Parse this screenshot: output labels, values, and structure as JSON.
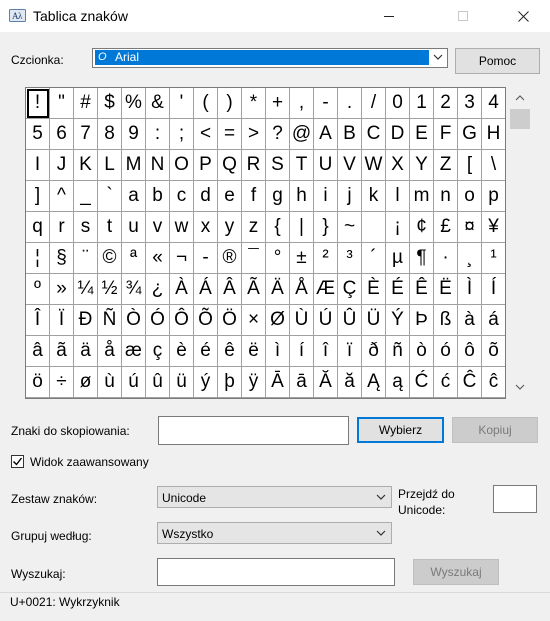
{
  "window": {
    "title": "Tablica znaków"
  },
  "font": {
    "label": "Czcionka:",
    "value": "Arial",
    "icon": "opentype-font-icon"
  },
  "help_button": "Pomoc",
  "grid": {
    "selected_index": 0,
    "rows": [
      [
        "!",
        "\"",
        "#",
        "$",
        "%",
        "&",
        "'",
        "(",
        ")",
        "*",
        "+",
        ",",
        "-",
        ".",
        "/",
        "0",
        "1",
        "2",
        "3",
        "4"
      ],
      [
        "5",
        "6",
        "7",
        "8",
        "9",
        ":",
        ";",
        "<",
        "=",
        ">",
        "?",
        "@",
        "A",
        "B",
        "C",
        "D",
        "E",
        "F",
        "G",
        "H"
      ],
      [
        "I",
        "J",
        "K",
        "L",
        "M",
        "N",
        "O",
        "P",
        "Q",
        "R",
        "S",
        "T",
        "U",
        "V",
        "W",
        "X",
        "Y",
        "Z",
        "[",
        "\\"
      ],
      [
        "]",
        "^",
        "_",
        "`",
        "a",
        "b",
        "c",
        "d",
        "e",
        "f",
        "g",
        "h",
        "i",
        "j",
        "k",
        "l",
        "m",
        "n",
        "o",
        "p"
      ],
      [
        "q",
        "r",
        "s",
        "t",
        "u",
        "v",
        "w",
        "x",
        "y",
        "z",
        "{",
        "|",
        "}",
        "~",
        " ",
        "¡",
        "¢",
        "£",
        "¤",
        "¥"
      ],
      [
        "¦",
        "§",
        "¨",
        "©",
        "ª",
        "«",
        "¬",
        "-",
        "®",
        "¯",
        "°",
        "±",
        "²",
        "³",
        "´",
        "µ",
        "¶",
        "·",
        "¸",
        "¹"
      ],
      [
        "º",
        "»",
        "¼",
        "½",
        "¾",
        "¿",
        "À",
        "Á",
        "Â",
        "Ã",
        "Ä",
        "Å",
        "Æ",
        "Ç",
        "È",
        "É",
        "Ê",
        "Ë",
        "Ì",
        "Í"
      ],
      [
        "Î",
        "Ï",
        "Ð",
        "Ñ",
        "Ò",
        "Ó",
        "Ô",
        "Õ",
        "Ö",
        "×",
        "Ø",
        "Ù",
        "Ú",
        "Û",
        "Ü",
        "Ý",
        "Þ",
        "ß",
        "à",
        "á"
      ],
      [
        "â",
        "ã",
        "ä",
        "å",
        "æ",
        "ç",
        "è",
        "é",
        "ê",
        "ë",
        "ì",
        "í",
        "î",
        "ï",
        "ð",
        "ñ",
        "ò",
        "ó",
        "ô",
        "õ"
      ],
      [
        "ö",
        "÷",
        "ø",
        "ù",
        "ú",
        "û",
        "ü",
        "ý",
        "þ",
        "ÿ",
        "Ā",
        "ā",
        "Ă",
        "ă",
        "Ą",
        "ą",
        "Ć",
        "ć",
        "Ĉ",
        "ĉ"
      ]
    ]
  },
  "copy": {
    "label": "Znaki do skopiowania:",
    "value": "",
    "select_button": "Wybierz",
    "copy_button": "Kopiuj"
  },
  "advanced": {
    "label": "Widok zaawansowany",
    "checked": true
  },
  "charset": {
    "label": "Zestaw znaków:",
    "value": "Unicode"
  },
  "goto_unicode": {
    "label_line1": "Przejdź do",
    "label_line2": "Unicode:",
    "value": ""
  },
  "group_by": {
    "label": "Grupuj według:",
    "value": "Wszystko"
  },
  "search": {
    "label": "Wyszukaj:",
    "value": "",
    "button": "Wyszukaj"
  },
  "status": "U+0021: Wykrzyknik"
}
